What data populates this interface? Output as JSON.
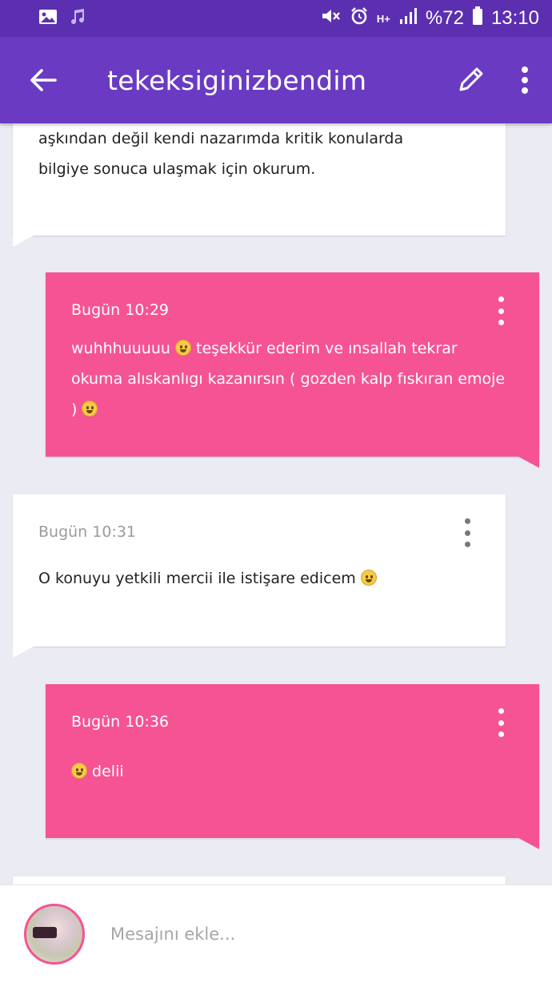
{
  "status_bar": {
    "battery_percent": "%72",
    "time": "13:10",
    "network": "H+"
  },
  "app_bar": {
    "title": "tekeksiginizbendim"
  },
  "messages": [
    {
      "direction": "in",
      "time": "",
      "text": "aşkından değil kendi nazarımda kritik konularda bilgiye sonuca ulaşmak için okurum."
    },
    {
      "direction": "out",
      "time": "Bugün 10:29",
      "text_part1": "wuhhhuuuuu",
      "text_part2": "teşekkür ederim ve ınsallah tekrar okuma alıskanlıgı kazanırsın ( gozden kalp fıskıran emoje )"
    },
    {
      "direction": "in",
      "time": "Bugün 10:31",
      "text": "O konuyu yetkili mercii ile istişare edicem"
    },
    {
      "direction": "out",
      "time": "Bugün 10:36",
      "text": "delii"
    }
  ],
  "composer": {
    "placeholder": "Mesajını ekle..."
  },
  "colors": {
    "status_bar": "#5b2fb0",
    "app_bar": "#6a3bc2",
    "outgoing_bubble": "#f55394",
    "incoming_bubble": "#ffffff",
    "background": "#ebebf3"
  }
}
